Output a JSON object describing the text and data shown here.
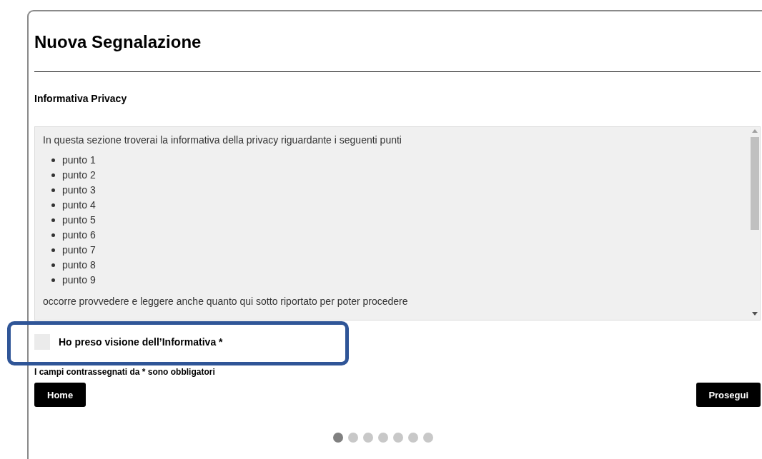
{
  "title": "Nuova Segnalazione",
  "section_title": "Informativa Privacy",
  "privacy_box": {
    "intro": "In questa sezione troverai la informativa della privacy riguardante i seguenti punti",
    "items": [
      "punto 1",
      "punto 2",
      "punto 3",
      "punto 4",
      "punto 5",
      "punto 6",
      "punto 7",
      "punto 8",
      "punto 9"
    ],
    "outro": "occorre provvedere e leggere anche quanto qui sotto riportato per poter procedere"
  },
  "consent": {
    "label": "Ho preso visione dell’Informativa *",
    "checked": false,
    "highlighted": true
  },
  "required_note": "I campi contrassegnati da * sono obbligatori",
  "buttons": {
    "back": "Home",
    "next": "Prosegui"
  },
  "steps": [
    {
      "selected": true
    },
    {
      "selected": false
    },
    {
      "selected": false
    },
    {
      "selected": false
    },
    {
      "selected": false
    },
    {
      "selected": false
    },
    {
      "selected": false
    }
  ]
}
